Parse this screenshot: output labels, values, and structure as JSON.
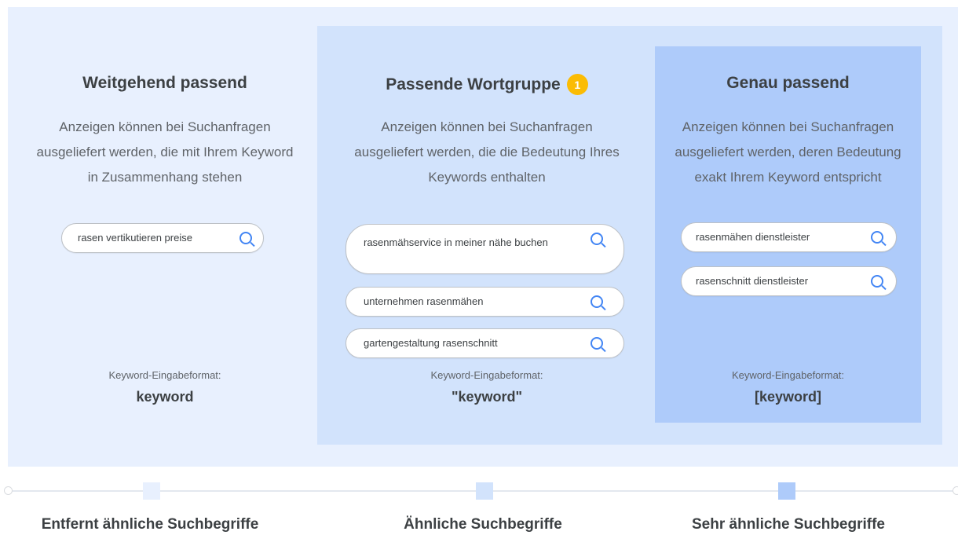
{
  "colors": {
    "outer_panel": "#e8f0fe",
    "mid_panel": "#d2e3fc",
    "inner_panel": "#aecbfa",
    "badge": "#fbbc04",
    "search_icon": "#4285f4",
    "marker_1": "#e8f0fe",
    "marker_2": "#d2e3fc",
    "marker_3": "#aecbfa"
  },
  "columns": [
    {
      "title": "Weitgehend passend",
      "description": "Anzeigen können bei Suchanfragen ausgeliefert werden, die mit Ihrem Keyword in Zusammenhang stehen",
      "queries": [
        "rasen vertikutieren preise"
      ],
      "format_label": "Keyword-Eingabeformat:",
      "format_value": "keyword"
    },
    {
      "title": "Passende Wortgruppe",
      "badge": "1",
      "description": "Anzeigen können bei Suchanfragen ausgeliefert werden, die die Bedeutung Ihres Keywords enthalten",
      "queries": [
        "rasenmähservice in meiner nähe buchen",
        "unternehmen rasenmähen",
        "gartengestaltung rasenschnitt"
      ],
      "format_label": "Keyword-Eingabeformat:",
      "format_value": "\"keyword\""
    },
    {
      "title": "Genau passend",
      "description": "Anzeigen können bei Suchanfragen ausgeliefert werden, deren Bedeutung exakt Ihrem Keyword entspricht",
      "queries": [
        "rasenmähen dienstleister",
        "rasenschnitt dienstleister"
      ],
      "format_label": "Keyword-Eingabeformat:",
      "format_value": "[keyword]"
    }
  ],
  "timeline": {
    "labels": [
      "Entfernt ähnliche Suchbegriffe",
      "Ähnliche Suchbegriffe",
      "Sehr ähnliche Suchbegriffe"
    ]
  }
}
